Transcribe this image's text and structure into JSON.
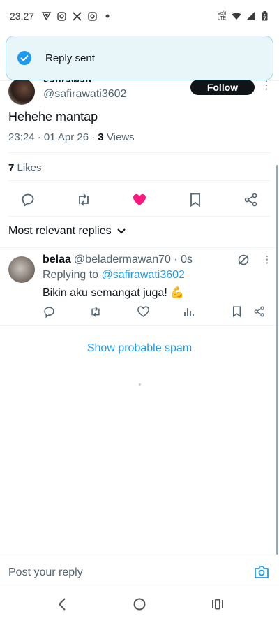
{
  "status_bar": {
    "time": "23.27",
    "left_icons": [
      "vpn-triangle-icon",
      "instagram-icon",
      "x-logo-icon",
      "instagram-icon",
      "notification-dot-icon"
    ],
    "volte": "Vo)) LTE",
    "right_icons": [
      "wifi-icon",
      "signal-icon",
      "battery-icon"
    ]
  },
  "toast": {
    "text": "Reply sent",
    "icon": "check-circle-icon"
  },
  "tweet": {
    "author_name": "safirawati",
    "author_handle": "@safirawati3602",
    "follow_label": "Follow",
    "text": "Hehehe mantap",
    "meta_prefix": "23:24 · 01 Apr 26 · ",
    "views_count": "3",
    "views_label": " Views",
    "likes_count": "7",
    "likes_label": " Likes",
    "liked": true
  },
  "sort": {
    "label": "Most relevant replies"
  },
  "reply": {
    "name": "belaa",
    "handle_time": "@beladermawan70 · 0s",
    "replying_prefix": "Replying to ",
    "replying_to": "@safirawati3602",
    "body": "Bikin aku semangat juga! 💪"
  },
  "spam_link": "Show probable spam",
  "compose": {
    "placeholder": "Post your reply"
  },
  "colors": {
    "accent": "#1d9bf0",
    "like": "#f91880",
    "text": "#0f1419",
    "muted": "#536471"
  }
}
